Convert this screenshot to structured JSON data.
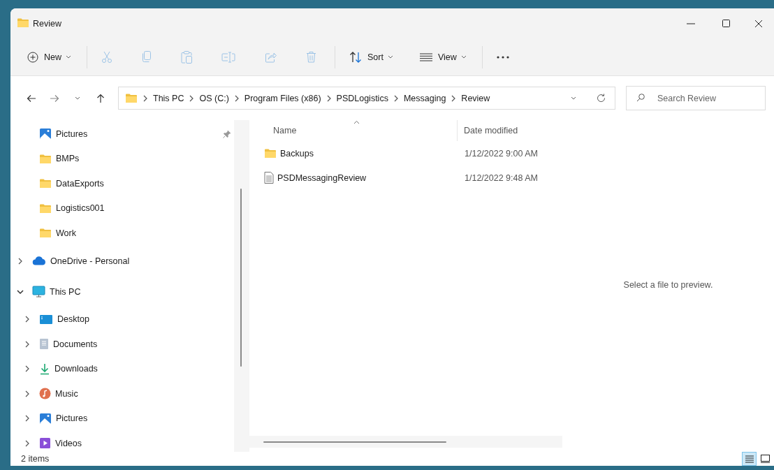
{
  "window": {
    "title": "Review"
  },
  "toolbar": [
    {
      "kind": "new",
      "label": "New",
      "disabled": false
    },
    {
      "kind": "separator"
    },
    {
      "kind": "cut",
      "disabled": true
    },
    {
      "kind": "copy",
      "disabled": true
    },
    {
      "kind": "paste",
      "disabled": true
    },
    {
      "kind": "rename",
      "disabled": true
    },
    {
      "kind": "share",
      "disabled": true
    },
    {
      "kind": "delete",
      "disabled": true
    },
    {
      "kind": "separator"
    },
    {
      "kind": "sort",
      "label": "Sort",
      "disabled": false
    },
    {
      "kind": "view",
      "label": "View",
      "disabled": false
    },
    {
      "kind": "separator"
    },
    {
      "kind": "more",
      "disabled": false
    }
  ],
  "address_bar": {
    "breadcrumbs": [
      "This PC",
      "OS (C:)",
      "Program Files (x86)",
      "PSDLogistics",
      "Messaging",
      "Review"
    ]
  },
  "search": {
    "placeholder": "Search Review"
  },
  "navigation": {
    "pinned": [
      {
        "label": "Pictures",
        "kind": "pictures",
        "pinned": true
      },
      {
        "label": "BMPs",
        "kind": "folder",
        "pinned": false
      },
      {
        "label": "DataExports",
        "kind": "folder",
        "pinned": false
      },
      {
        "label": "Logistics001",
        "kind": "folder",
        "pinned": false
      },
      {
        "label": "Work",
        "kind": "folder",
        "pinned": false
      }
    ],
    "tree": [
      {
        "label": "OneDrive - Personal",
        "kind": "cloud",
        "expanded": false
      },
      {
        "label": "This PC",
        "kind": "pc",
        "expanded": true,
        "children": [
          {
            "label": "Desktop",
            "kind": "desktop",
            "expanded": false
          },
          {
            "label": "Documents",
            "kind": "documents",
            "expanded": false
          },
          {
            "label": "Downloads",
            "kind": "downloads",
            "expanded": false
          },
          {
            "label": "Music",
            "kind": "music",
            "expanded": false
          },
          {
            "label": "Pictures",
            "kind": "pictures",
            "expanded": false
          },
          {
            "label": "Videos",
            "kind": "videos",
            "expanded": false
          }
        ]
      }
    ]
  },
  "file_list": {
    "columns": [
      {
        "label": "Name",
        "sorted": true
      },
      {
        "label": "Date modified",
        "sorted": false
      }
    ],
    "rows": [
      {
        "kind": "folder",
        "name": "Backups",
        "date_modified": "1/12/2022 9:00 AM"
      },
      {
        "kind": "file",
        "name": "PSDMessagingReview",
        "date_modified": "1/12/2022 9:48 AM"
      }
    ]
  },
  "preview": {
    "message": "Select a file to preview."
  },
  "status_bar": {
    "item_count": "2 items",
    "views": [
      {
        "kind": "details",
        "selected": true
      },
      {
        "kind": "tiles",
        "selected": false
      }
    ]
  }
}
